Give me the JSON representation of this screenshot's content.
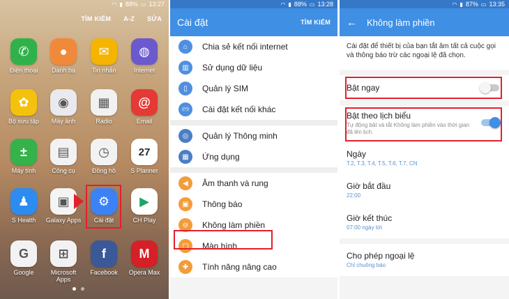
{
  "home": {
    "status": {
      "battery": "88%",
      "time": "13:27"
    },
    "topbar": [
      "TÌM KIẾM",
      "A-Z",
      "SỬA"
    ],
    "apps": [
      {
        "label": "Điện thoại",
        "icon": "phone-icon",
        "color": "#2fb24a",
        "glyph": "✆"
      },
      {
        "label": "Danh bạ",
        "icon": "contacts-icon",
        "color": "#f08a3a",
        "glyph": "●"
      },
      {
        "label": "Tin nhắn",
        "icon": "messages-icon",
        "color": "#f4b400",
        "glyph": "✉"
      },
      {
        "label": "Internet",
        "icon": "internet-icon",
        "color": "#6a5acd",
        "glyph": "◍"
      },
      {
        "label": "Bộ sưu tập",
        "icon": "gallery-icon",
        "color": "#f4c20d",
        "glyph": "✿"
      },
      {
        "label": "Máy ảnh",
        "icon": "camera-icon",
        "color": "#e9e9ee",
        "glyph": "◉"
      },
      {
        "label": "Radio",
        "icon": "radio-icon",
        "color": "#f1f1f1",
        "glyph": "▦"
      },
      {
        "label": "Email",
        "icon": "email-icon",
        "color": "#e53935",
        "glyph": "@"
      },
      {
        "label": "Máy tính",
        "icon": "calculator-icon",
        "color": "#35b24a",
        "glyph": "±"
      },
      {
        "label": "Công cụ",
        "icon": "tools-folder-icon",
        "color": "#f2f2f2",
        "glyph": "▤"
      },
      {
        "label": "Đồng hồ",
        "icon": "clock-icon",
        "color": "#f2f2f2",
        "glyph": "◷"
      },
      {
        "label": "S Planner",
        "icon": "calendar-icon",
        "color": "#ffffff",
        "glyph": "27"
      },
      {
        "label": "S Health",
        "icon": "s-health-icon",
        "color": "#2d8cf0",
        "glyph": "♟"
      },
      {
        "label": "Galaxy Apps",
        "icon": "galaxy-apps-icon",
        "color": "#f4f4f4",
        "glyph": "▣"
      },
      {
        "label": "Cài đặt",
        "icon": "settings-gear-icon",
        "color": "#3b82f6",
        "glyph": "⚙"
      },
      {
        "label": "CH Play",
        "icon": "play-store-icon",
        "color": "#ffffff",
        "glyph": "▶"
      },
      {
        "label": "Google",
        "icon": "google-folder-icon",
        "color": "#f2f2f2",
        "glyph": "G"
      },
      {
        "label": "Microsoft Apps",
        "icon": "microsoft-folder-icon",
        "color": "#f2f2f2",
        "glyph": "⊞"
      },
      {
        "label": "Facebook",
        "icon": "facebook-icon",
        "color": "#3b5998",
        "glyph": "f"
      },
      {
        "label": "Opera Max",
        "icon": "opera-max-icon",
        "color": "#d61f26",
        "glyph": "M"
      }
    ]
  },
  "settings": {
    "status": {
      "battery": "88%",
      "time": "13:28"
    },
    "title": "Cài đặt",
    "action": "TÌM KIẾM",
    "groups": [
      [
        {
          "label": "Chia sẻ kết nối internet",
          "icon": "hotspot-icon",
          "color": "#4f8fe0"
        },
        {
          "label": "Sử dụng dữ liệu",
          "icon": "data-usage-icon",
          "color": "#4f8fe0"
        },
        {
          "label": "Quản lý SIM",
          "icon": "sim-card-icon",
          "color": "#4f8fe0"
        },
        {
          "label": "Cài đặt kết nối khác",
          "icon": "more-connections-icon",
          "color": "#4f8fe0"
        }
      ],
      [
        {
          "label": "Quản lý Thông minh",
          "icon": "smart-manager-icon",
          "color": "#4a7ec6"
        },
        {
          "label": "Ứng dụng",
          "icon": "apps-icon",
          "color": "#4a7ec6"
        }
      ],
      [
        {
          "label": "Âm thanh và rung",
          "icon": "sound-icon",
          "color": "#f39c3a"
        },
        {
          "label": "Thông báo",
          "icon": "notifications-icon",
          "color": "#f39c3a"
        },
        {
          "label": "Không làm phiền",
          "icon": "do-not-disturb-icon",
          "color": "#f39c3a"
        },
        {
          "label": "Màn hình",
          "icon": "display-icon",
          "color": "#f39c3a"
        },
        {
          "label": "Tính năng nâng cao",
          "icon": "advanced-features-icon",
          "color": "#f39c3a"
        }
      ]
    ]
  },
  "dnd": {
    "status": {
      "battery": "87%",
      "time": "13:35"
    },
    "title": "Không làm phiền",
    "description": "Cài đặt để thiết bị của bạn tắt âm tất cả cuộc gọi và thông báo trừ các ngoại lệ đã chọn.",
    "turn_on_now": {
      "label": "Bật ngay",
      "enabled": false
    },
    "scheduled": {
      "label": "Bật theo lịch biểu",
      "sub": "Tự động bật và tắt Không làm phiền vào thời gian đã lên lịch.",
      "enabled": true
    },
    "days": {
      "label": "Ngày",
      "value": "T.2, T.3, T.4, T.5, T.6, T.7, CN"
    },
    "start": {
      "label": "Giờ bắt đầu",
      "value": "22:00"
    },
    "end": {
      "label": "Giờ kết thúc",
      "value": "07:00 ngày tới"
    },
    "exceptions": {
      "label": "Cho phép ngoại lệ",
      "value": "Chỉ chuông báo"
    }
  },
  "colors": {
    "accent": "#3f8fe4",
    "highlight": "#e2202c"
  }
}
